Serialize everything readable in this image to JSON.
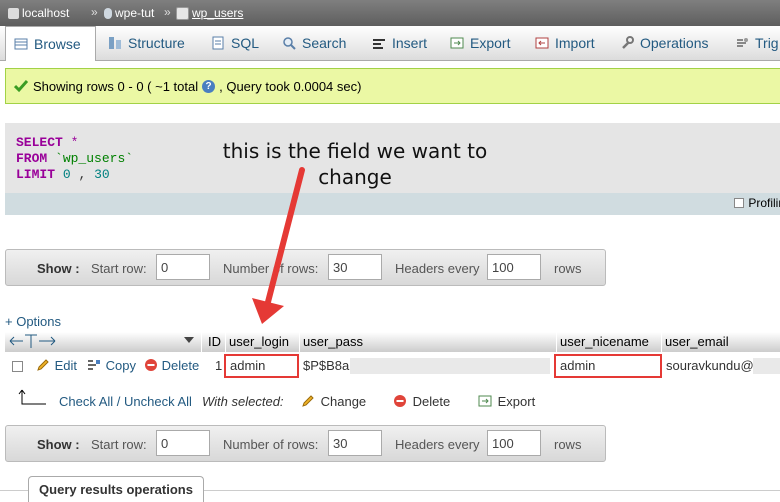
{
  "breadcrumb": {
    "server": "localhost",
    "database": "wpe-tut",
    "table": "wp_users",
    "separator": "»"
  },
  "tabs": [
    {
      "label": "Browse",
      "icon": "browse-icon"
    },
    {
      "label": "Structure",
      "icon": "structure-icon"
    },
    {
      "label": "SQL",
      "icon": "sql-icon"
    },
    {
      "label": "Search",
      "icon": "search-icon"
    },
    {
      "label": "Insert",
      "icon": "insert-icon"
    },
    {
      "label": "Export",
      "icon": "export-icon"
    },
    {
      "label": "Import",
      "icon": "import-icon"
    },
    {
      "label": "Operations",
      "icon": "operations-icon"
    },
    {
      "label": "Trig",
      "icon": "triggers-icon"
    }
  ],
  "message": {
    "part1": "Showing rows 0 - 0 ( ~1 total",
    "part2": ", Query took 0.0004 sec)"
  },
  "sql": {
    "select": "SELECT",
    "star": "*",
    "from": "FROM",
    "table": "`wp_users`",
    "limit": "LIMIT",
    "offset": "0",
    "comma": ",",
    "count": "30",
    "profiling": "Profilin"
  },
  "annotation": {
    "line1": "this is the field we want to",
    "line2": "change"
  },
  "nav": {
    "show": "Show :",
    "start_row_label": "Start row:",
    "start_row": "0",
    "num_rows_label": "Number of rows:",
    "num_rows": "30",
    "headers_every_label": "Headers every",
    "headers_every": "100",
    "rows": "rows"
  },
  "options_link": "+ Options",
  "headers": {
    "id": "ID",
    "user_login": "user_login",
    "user_pass": "user_pass",
    "user_nicename": "user_nicename",
    "user_email": "user_email"
  },
  "row": {
    "edit": "Edit",
    "copy": "Copy",
    "delete": "Delete",
    "id": "1",
    "user_login": "admin",
    "user_pass": "$P$B8a",
    "user_nicename": "admin",
    "user_email": "souravkundu@"
  },
  "with_selected": {
    "check_all": "Check All / Uncheck All",
    "label": "With selected:",
    "change": "Change",
    "delete": "Delete",
    "export": "Export"
  },
  "footer_tab": "Query results operations",
  "colors": {
    "link": "#235a81",
    "keyword": "#990099",
    "success_bg": "#ebf8a4",
    "annotation_red": "#e53935"
  }
}
